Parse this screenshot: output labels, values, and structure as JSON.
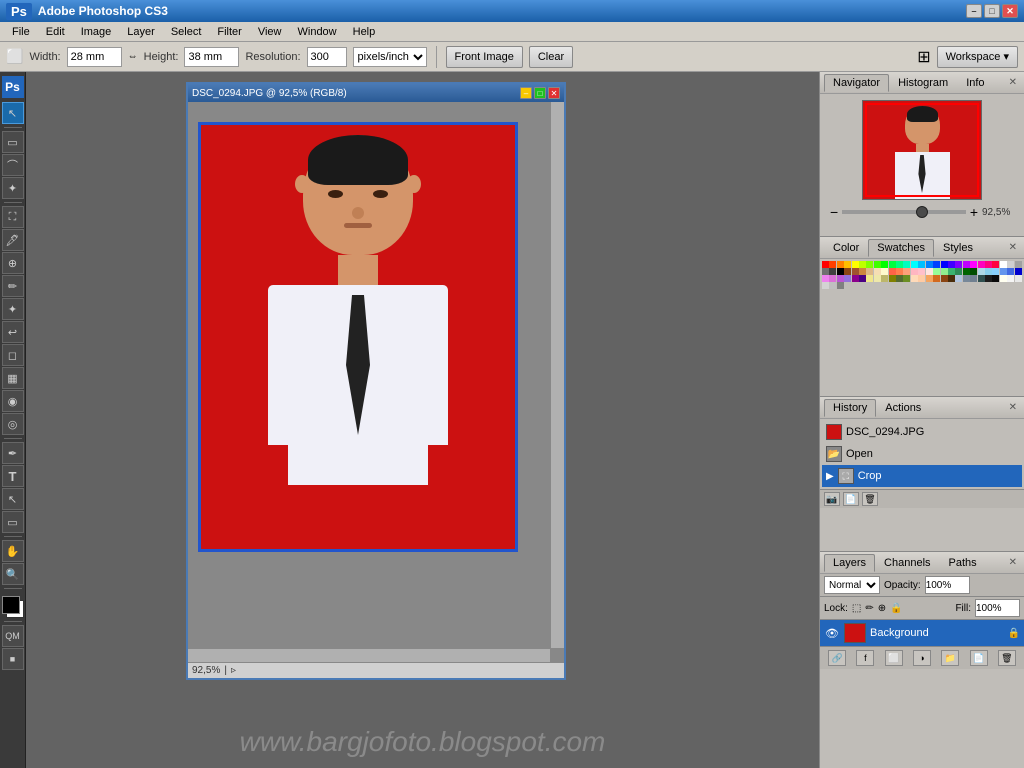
{
  "app": {
    "title": "Adobe Photoshop CS3",
    "ps_logo": "Ps"
  },
  "titlebar": {
    "title": "Adobe Photoshop CS3",
    "btn_min": "–",
    "btn_max": "□",
    "btn_close": "✕"
  },
  "menubar": {
    "items": [
      "File",
      "Edit",
      "Image",
      "Layer",
      "Select",
      "Filter",
      "View",
      "Window",
      "Help"
    ]
  },
  "optionsbar": {
    "width_label": "Width:",
    "width_value": "28 mm",
    "height_label": "Height:",
    "height_value": "38 mm",
    "resolution_label": "Resolution:",
    "resolution_value": "300",
    "resolution_unit": "pixels/inch",
    "front_image_btn": "Front Image",
    "clear_btn": "Clear",
    "workspace_btn": "Workspace ▾"
  },
  "document": {
    "title": "DSC_0294.JPG @ 92,5% (RGB/8)",
    "zoom": "92,5%",
    "btn_min": "–",
    "btn_max": "□",
    "btn_close": "✕"
  },
  "navigator": {
    "tab_navigator": "Navigator",
    "tab_histogram": "Histogram",
    "tab_info": "Info",
    "zoom_value": "92,5%"
  },
  "color_panel": {
    "tab_color": "Color",
    "tab_swatches": "Swatches",
    "tab_styles": "Styles"
  },
  "history_panel": {
    "tab_history": "History",
    "tab_actions": "Actions",
    "items": [
      {
        "name": "DSC_0294.JPG",
        "type": "file"
      },
      {
        "name": "Open",
        "type": "open"
      },
      {
        "name": "Crop",
        "type": "crop",
        "active": true
      }
    ]
  },
  "layers_panel": {
    "tab_layers": "Layers",
    "tab_channels": "Channels",
    "tab_paths": "Paths",
    "mode": "Normal",
    "opacity_label": "Opacity:",
    "opacity_value": "100%",
    "fill_label": "Fill:",
    "fill_value": "100%",
    "lock_label": "Lock:",
    "layers": [
      {
        "name": "Background",
        "visible": true,
        "locked": true
      }
    ]
  },
  "watermark": "www.bargjofoto.blogspot.com",
  "swatches": {
    "colors": [
      "#ff0000",
      "#ff4000",
      "#ff8000",
      "#ffbf00",
      "#ffff00",
      "#bfff00",
      "#80ff00",
      "#40ff00",
      "#00ff00",
      "#00ff40",
      "#00ff80",
      "#00ffbf",
      "#00ffff",
      "#00bfff",
      "#0080ff",
      "#0040ff",
      "#0000ff",
      "#4000ff",
      "#8000ff",
      "#bf00ff",
      "#ff00ff",
      "#ff00bf",
      "#ff0080",
      "#ff0040",
      "#ffffff",
      "#d0d0d0",
      "#a0a0a0",
      "#707070",
      "#404040",
      "#000000",
      "#8b4513",
      "#a0522d",
      "#cd853f",
      "#deb887",
      "#f5deb3",
      "#fffacd",
      "#ff6347",
      "#ff7f50",
      "#ffa07a",
      "#ffb6c1",
      "#ffc0cb",
      "#ffe4e1",
      "#98fb98",
      "#90ee90",
      "#3cb371",
      "#2e8b57",
      "#006400",
      "#004d00",
      "#add8e6",
      "#87ceeb",
      "#87cefa",
      "#6495ed",
      "#4169e1",
      "#0000cd",
      "#ee82ee",
      "#da70d6",
      "#ba55d3",
      "#9370db",
      "#8b008b",
      "#4b0082",
      "#f0e68c",
      "#eee8aa",
      "#bdb76b",
      "#808000",
      "#556b2f",
      "#6b8e23",
      "#ffdab9",
      "#ffcba4",
      "#f4a460",
      "#d2691e",
      "#8b4513",
      "#4a2c0a",
      "#b0c4de",
      "#778899",
      "#708090",
      "#2f4f4f",
      "#1c1c1c",
      "#0a0a0a",
      "#fffff0",
      "#f5f5f5",
      "#e8e8e8",
      "#d3d3d3",
      "#c0c0c0",
      "#808080"
    ]
  }
}
